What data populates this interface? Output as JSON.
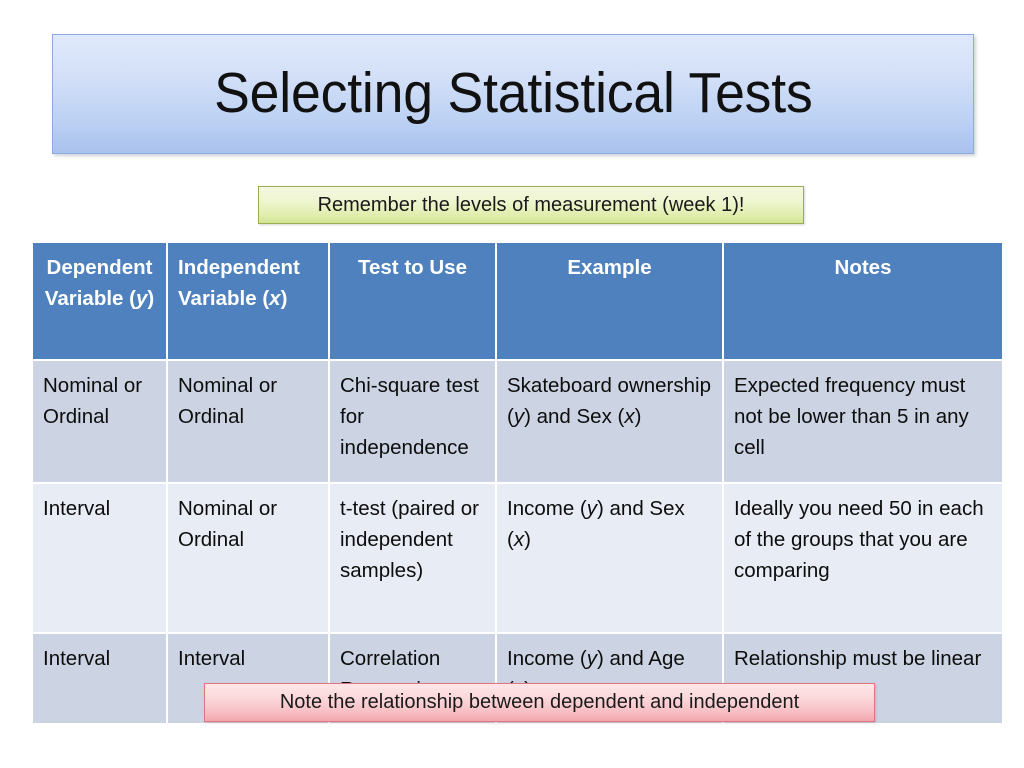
{
  "slide": {
    "title": "Selecting Statistical Tests",
    "note_top": "Remember the levels of measurement (week 1)!",
    "note_bottom": "Note the relationship between dependent and independent"
  },
  "colors": {
    "header_blue": "#4e81bd",
    "row_dark": "#ccd3e2",
    "row_light": "#e8ecf4",
    "title_banner_top": "#e0e9fa",
    "title_banner_bottom": "#a9c2ee",
    "green_callout_border": "#9aad52",
    "pink_callout_border": "#e2747e"
  },
  "table": {
    "headers": [
      "Dependent Variable (y)",
      "Independent Variable (x)",
      "Test to Use",
      "Example",
      "Notes"
    ],
    "rows": [
      {
        "dependent_variable": "Nominal or Ordinal",
        "independent_variable": "Nominal or Ordinal",
        "test_to_use": "Chi-square test for independence",
        "example": "Skateboard ownership (y) and Sex (x)",
        "notes": "Expected frequency must not be lower than 5 in any cell"
      },
      {
        "dependent_variable": "Interval",
        "independent_variable": "Nominal or Ordinal",
        "test_to_use": "t-test (paired or independent samples)",
        "example": "Income (y) and Sex (x)",
        "notes": "Ideally you need 50 in each of the groups that you are comparing"
      },
      {
        "dependent_variable": "Interval",
        "independent_variable": "Interval",
        "test_to_use": "Correlation Regression",
        "example": "Income (y) and Age (x)",
        "notes": "Relationship must be linear"
      }
    ]
  }
}
